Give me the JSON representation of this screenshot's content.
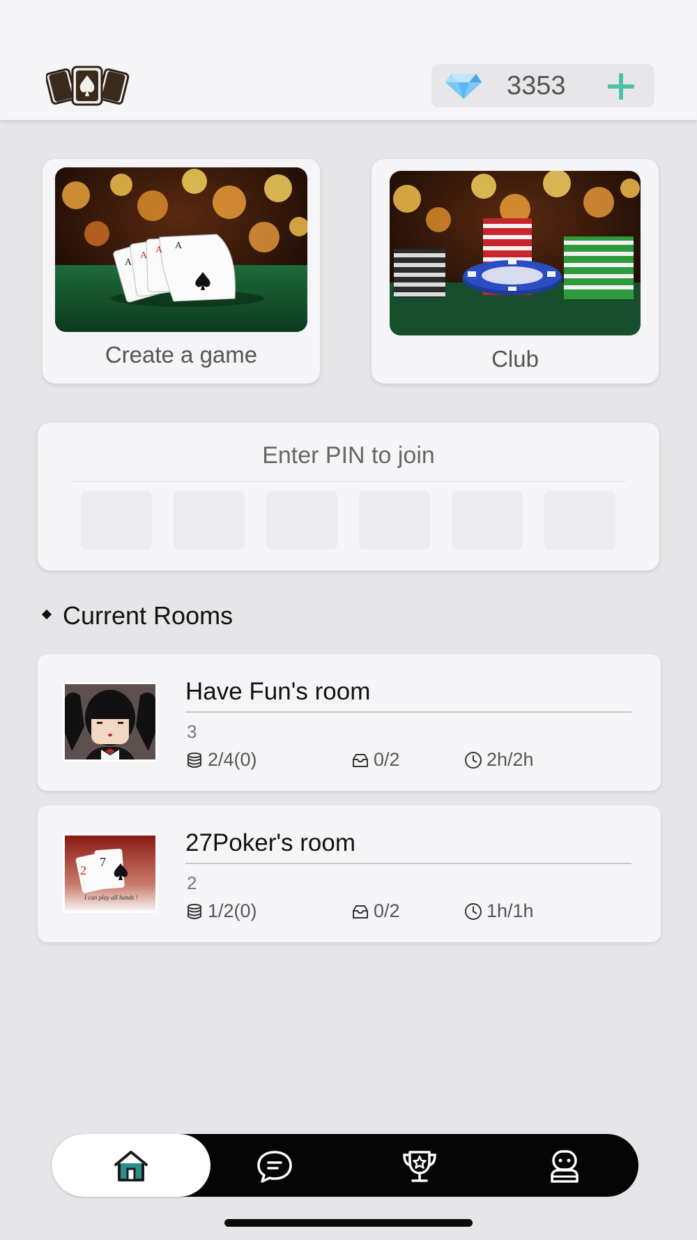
{
  "header": {
    "gems": "3353",
    "colors": {
      "gem": "#5ab8ee",
      "plus": "#4fbfa8"
    }
  },
  "tiles": {
    "create_label": "Create a game",
    "club_label": "Club"
  },
  "pin": {
    "title": "Enter PIN to join",
    "boxes": [
      "",
      "",
      "",
      "",
      "",
      ""
    ]
  },
  "rooms_section": {
    "title": "Current Rooms"
  },
  "rooms": [
    {
      "name": "Have Fun's room",
      "count": "3",
      "blinds": "2/4(0)",
      "seats": "0/2",
      "time": "2h/2h"
    },
    {
      "name": "27Poker's room",
      "count": "2",
      "blinds": "1/2(0)",
      "seats": "0/2",
      "time": "1h/1h",
      "avatar_caption": "I can play all hands !"
    }
  ],
  "nav": {
    "items": [
      "home-icon",
      "chat-icon",
      "trophy-icon",
      "profile-icon"
    ],
    "active": "home-icon",
    "accent": "#2a8c8c"
  }
}
